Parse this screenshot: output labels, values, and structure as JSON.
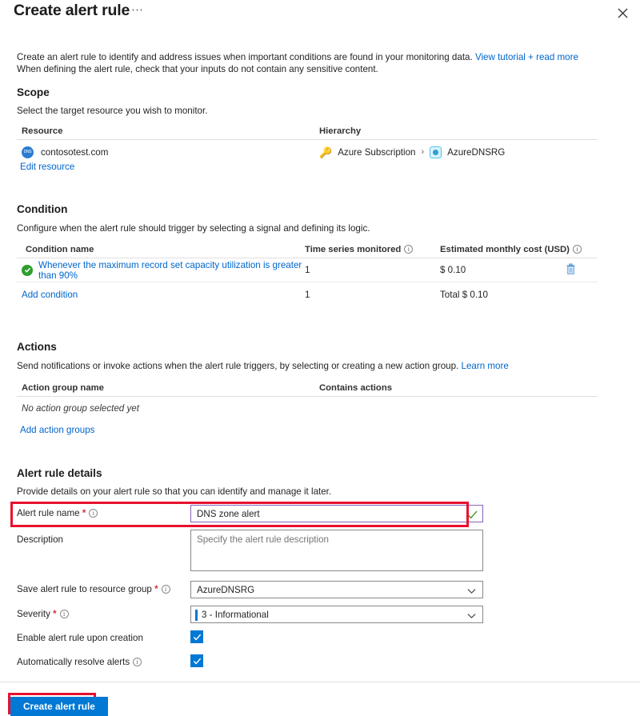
{
  "header": {
    "title": "Create alert rule",
    "ellipsis_label": "⋯",
    "close_label": "close-icon"
  },
  "intro": {
    "line1_a": "Create an alert rule to identify and address issues when important conditions are found in your monitoring data. ",
    "line1_link": "View tutorial + read more",
    "line2": "When defining the alert rule, check that your inputs do not contain any sensitive content."
  },
  "scope": {
    "title": "Scope",
    "subtitle": "Select the target resource you wish to monitor.",
    "columns": [
      "Resource",
      "Hierarchy"
    ],
    "resource": {
      "name": "contosotest.com",
      "icon": "dns-zone-icon"
    },
    "hierarchy": {
      "subscription": "Azure Subscription",
      "separator": "›",
      "resource_group": "AzureDNSRG",
      "subscription_icon": "key-icon",
      "resource_group_icon": "resource-group-icon"
    },
    "edit_link": "Edit resource"
  },
  "condition": {
    "title": "Condition",
    "subtitle": "Configure when the alert rule should trigger by selecting a signal and defining its logic.",
    "columns": {
      "name": "Condition name",
      "series": "Time series monitored",
      "cost": "Estimated monthly cost (USD)"
    },
    "rows": [
      {
        "name": "Whenever the maximum record set capacity utilization is greater than 90%",
        "series": "1",
        "cost": "$ 0.10",
        "status_icon": "check-circle-icon",
        "delete_icon": "trash-icon"
      }
    ],
    "add_link": "Add condition",
    "total_series": "1",
    "total_cost": "Total $ 0.10"
  },
  "actions": {
    "title": "Actions",
    "subtitle_a": "Send notifications or invoke actions when the alert rule triggers, by selecting or creating a new action group. ",
    "subtitle_link": "Learn more",
    "columns": [
      "Action group name",
      "Contains actions"
    ],
    "empty_text": "No action group selected yet",
    "add_link": "Add action groups"
  },
  "details": {
    "title": "Alert rule details",
    "subtitle": "Provide details on your alert rule so that you can identify and manage it later.",
    "fields": {
      "alert_rule_name": {
        "label": "Alert rule name",
        "required": true,
        "value": "DNS zone alert",
        "valid_icon": "check-icon"
      },
      "description": {
        "label": "Description",
        "value": "",
        "placeholder": "Specify the alert rule description"
      },
      "resource_group": {
        "label": "Save alert rule to resource group",
        "required": true,
        "value": "AzureDNSRG"
      },
      "severity": {
        "label": "Severity",
        "required": true,
        "value": "3 - Informational",
        "indicator_color": "#0078d4"
      },
      "enable_on_creation": {
        "label": "Enable alert rule upon creation",
        "checked": true
      },
      "auto_resolve": {
        "label": "Automatically resolve alerts",
        "checked": true
      }
    }
  },
  "footer": {
    "create_button": "Create alert rule"
  },
  "colors": {
    "accent": "#0078d4",
    "link": "#0066cc",
    "highlight_box": "#e8112d",
    "success": "#2e9e2e",
    "valid_border": "#8764b8",
    "required": "#d13438"
  }
}
